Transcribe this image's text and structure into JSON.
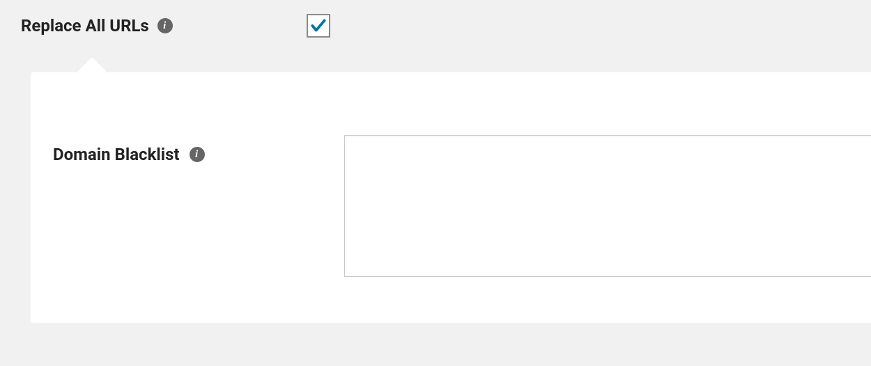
{
  "settings": {
    "replace_all_urls": {
      "label": "Replace All URLs",
      "checked": true
    },
    "domain_blacklist": {
      "label": "Domain Blacklist",
      "value": ""
    }
  }
}
